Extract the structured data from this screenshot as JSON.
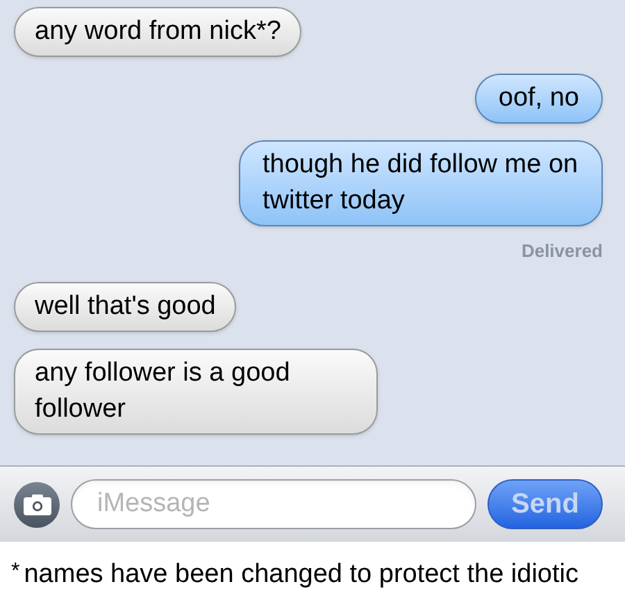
{
  "messages": [
    {
      "kind": "received",
      "text": "any word from nick*?"
    },
    {
      "kind": "sent",
      "text": "oof, no"
    },
    {
      "kind": "sent",
      "text": "though he did follow me on twitter today"
    },
    {
      "kind": "status",
      "text": "Delivered"
    },
    {
      "kind": "received",
      "text": "well that's good"
    },
    {
      "kind": "received",
      "text": "any follower is a good follower"
    }
  ],
  "composer": {
    "placeholder": "iMessage",
    "send": "Send"
  },
  "caption": {
    "mark": "*",
    "text": "names have been changed to protect the idiotic"
  }
}
